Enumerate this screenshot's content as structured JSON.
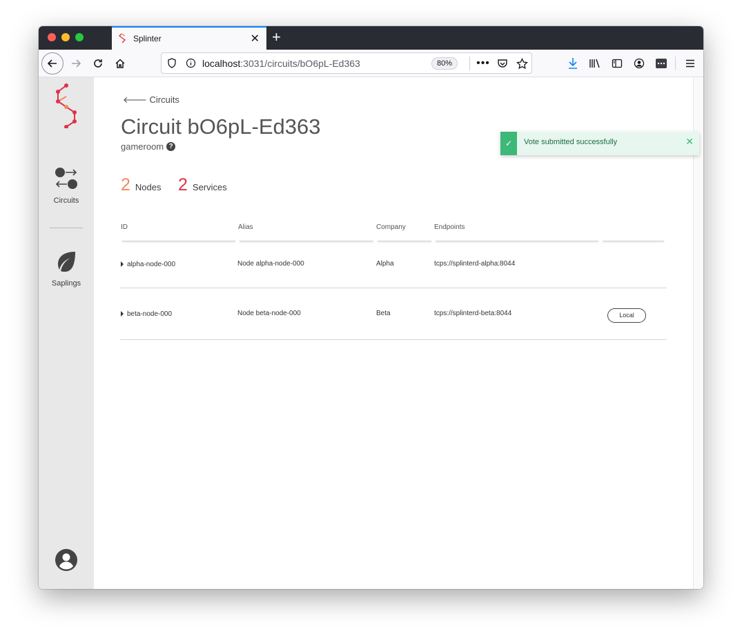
{
  "browser": {
    "tab_title": "Splinter",
    "url_host": "localhost",
    "url_path": ":3031/circuits/bO6pL-Ed363",
    "zoom": "80%"
  },
  "sidebar": {
    "items": [
      {
        "label": "Circuits",
        "icon": "circuits-icon"
      },
      {
        "label": "Saplings",
        "icon": "leaf-icon"
      }
    ]
  },
  "page": {
    "back_label": "Circuits",
    "title": "Circuit bO6pL-Ed363",
    "subtitle": "gameroom",
    "stats": [
      {
        "value": "2",
        "label": "Nodes",
        "color": "#f08a5d"
      },
      {
        "value": "2",
        "label": "Services",
        "color": "#e0314b"
      }
    ]
  },
  "table": {
    "headers": [
      "ID",
      "Alias",
      "Company",
      "Endpoints"
    ],
    "rows": [
      {
        "id": "alpha-node-000",
        "alias": "Node alpha-node-000",
        "company": "Alpha",
        "endpoint": "tcps://splinterd-alpha:8044",
        "badge": ""
      },
      {
        "id": "beta-node-000",
        "alias": "Node beta-node-000",
        "company": "Beta",
        "endpoint": "tcps://splinterd-beta:8044",
        "badge": "Local"
      }
    ]
  },
  "toast": {
    "message": "Vote submitted successfully",
    "accent": "#3cb878"
  }
}
